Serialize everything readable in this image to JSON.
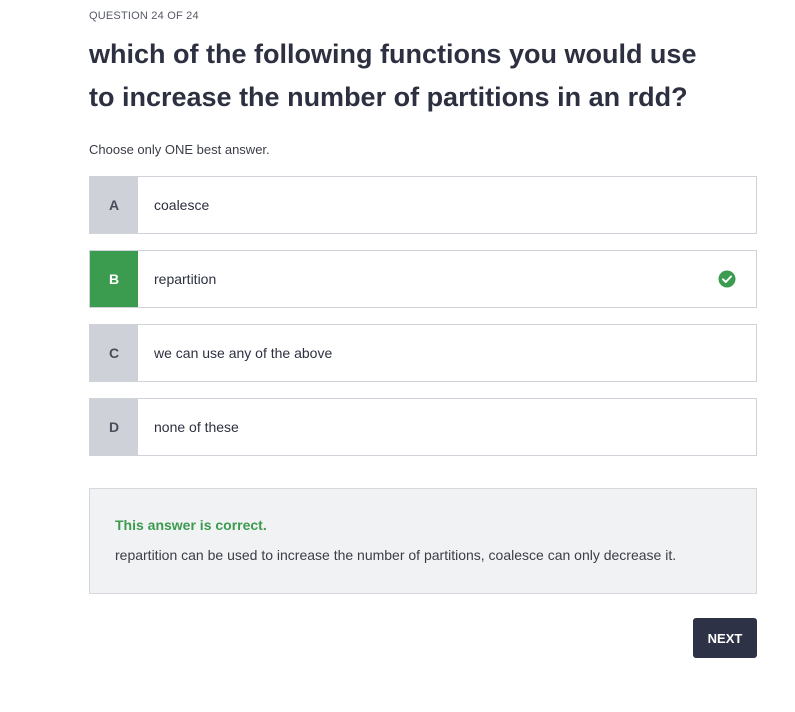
{
  "header": {
    "counter": "QUESTION 24 OF 24",
    "question": "which of the following functions you would use to increase the number of partitions in an rdd?",
    "instruction": "Choose only ONE best answer."
  },
  "options": [
    {
      "letter": "A",
      "text": "coalesce",
      "selected": false
    },
    {
      "letter": "B",
      "text": "repartition",
      "selected": true,
      "icon": "check-circle-icon"
    },
    {
      "letter": "C",
      "text": "we can use any of the above",
      "selected": false
    },
    {
      "letter": "D",
      "text": "none of these",
      "selected": false
    }
  ],
  "feedback": {
    "title": "This answer is correct.",
    "explanation": "repartition can be used to increase the number of partitions, coalesce can only decrease it."
  },
  "actions": {
    "next_label": "NEXT"
  },
  "colors": {
    "correct_green": "#3b9b4f",
    "button_dark": "#2e3246",
    "letter_gray": "#cfd1d9"
  }
}
